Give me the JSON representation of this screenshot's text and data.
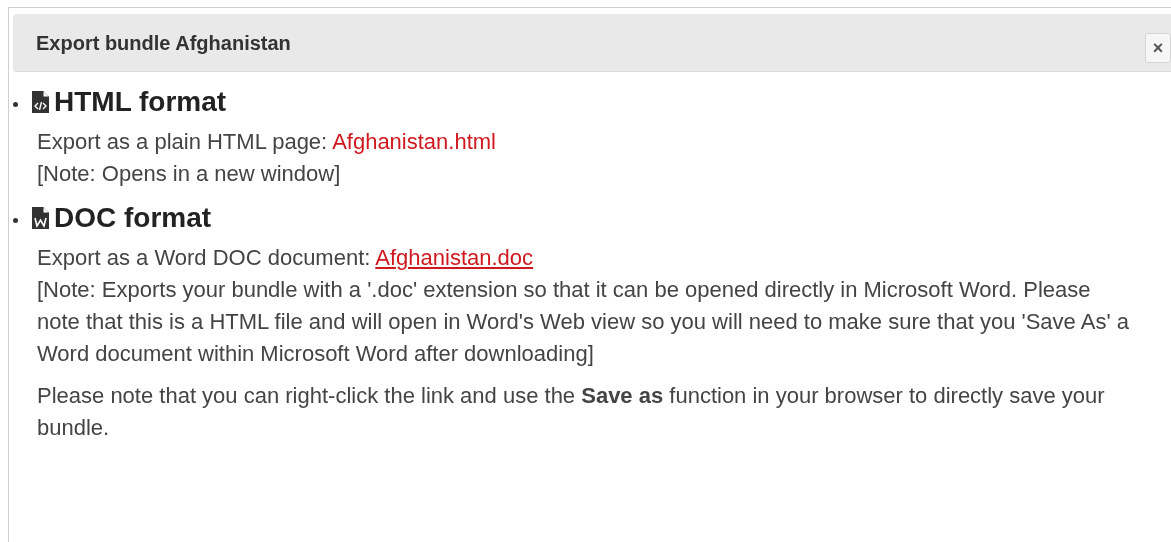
{
  "dialog": {
    "title": "Export bundle Afghanistan",
    "close_label": "×"
  },
  "formats": [
    {
      "kind": "html",
      "heading": "HTML format",
      "description": "Export as a plain HTML page: ",
      "link": {
        "label": "Afghanistan.html",
        "hovered": false
      },
      "note": "[Note: Opens in a new window]"
    },
    {
      "kind": "doc",
      "heading": "DOC format",
      "description": "Export as a Word DOC document: ",
      "link": {
        "label": "Afghanistan.doc",
        "hovered": true
      },
      "note": "[Note: Exports your bundle with a '.doc' extension so that it can be opened directly in Microsoft Word. Please note that this is a HTML file and will open in Word's Web view so you will need to make sure that you 'Save As' a Word document within Microsoft Word after downloading]"
    }
  ],
  "footer_note": "Please note that you can right-click the link and use the **Save as** function in your browser to directly save your bundle."
}
